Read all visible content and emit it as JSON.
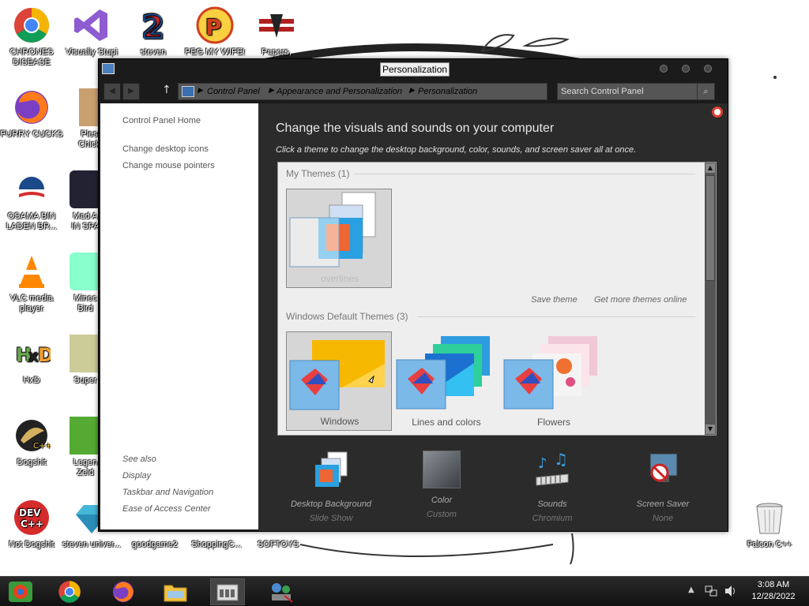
{
  "desktop": {
    "icons": [
      {
        "label": "CHRONES DISEASE",
        "icon": "chrome-icon"
      },
      {
        "label": "Visually Stupi",
        "icon": "visual-studio-icon"
      },
      {
        "label": "steven",
        "icon": "steven-icon"
      },
      {
        "label": "PEG MY WIFE!",
        "icon": "peggle-icon"
      },
      {
        "label": "Papers,",
        "icon": "papers-please-icon"
      },
      {
        "label": "FURRY CUCKS",
        "icon": "firefox-icon"
      },
      {
        "label": "Plese Chicke",
        "icon": "game-icon"
      },
      {
        "label": "OSAMA BIN LADEN BR...",
        "icon": "obama-logo-icon"
      },
      {
        "label": "Mad A IN SPA",
        "icon": "angry-birds-space-icon"
      },
      {
        "label": "VLC media player",
        "icon": "vlc-icon"
      },
      {
        "label": "Minec Bird",
        "icon": "angry-birds-icon"
      },
      {
        "label": "HxD",
        "icon": "hxd-icon"
      },
      {
        "label": "Super",
        "icon": "pixel-game-icon"
      },
      {
        "label": "Dogshit",
        "icon": "codeblocks-icon"
      },
      {
        "label": "Legen Zeld",
        "icon": "zelda-icon"
      },
      {
        "label": "Not Dogshit",
        "icon": "devcpp-icon"
      },
      {
        "label": "steven univer...",
        "icon": "gem-icon"
      },
      {
        "label": "goodgame2",
        "icon": "blank-icon"
      },
      {
        "label": "ShoppingC...",
        "icon": "blank-icon"
      },
      {
        "label": "SOFTOYS",
        "icon": "blank-icon"
      },
      {
        "label": "Falcon C++",
        "icon": "recycle-bin-icon"
      }
    ]
  },
  "window": {
    "title": "Personalization",
    "breadcrumbs": [
      "Control Panel",
      "Appearance and Personalization",
      "Personalization"
    ],
    "search_placeholder": "Search Control Panel",
    "left_pane": {
      "links": [
        "Control Panel Home",
        "Change desktop icons",
        "Change mouse pointers"
      ],
      "see_also_heading": "See also",
      "see_also": [
        "Display",
        "Taskbar and Navigation",
        "Ease of Access Center"
      ]
    },
    "main": {
      "heading": "Change the visuals and sounds on your computer",
      "subheading": "Click a theme to change the desktop background, color, sounds, and screen saver all at once.",
      "my_themes_label": "My Themes (1)",
      "my_themes": [
        {
          "name": "overlines"
        }
      ],
      "save_theme": "Save theme",
      "get_more": "Get more themes online",
      "default_themes_label": "Windows Default Themes (3)",
      "default_themes": [
        {
          "name": "Windows"
        },
        {
          "name": "Lines and colors"
        },
        {
          "name": "Flowers"
        }
      ],
      "bottom": [
        {
          "label": "Desktop Background",
          "value": "Slide Show",
          "icon": "slideshow-icon"
        },
        {
          "label": "Color",
          "value": "Custom",
          "icon": "color-swatch-icon"
        },
        {
          "label": "Sounds",
          "value": "Chromium",
          "icon": "sounds-icon"
        },
        {
          "label": "Screen Saver",
          "value": "None",
          "icon": "screensaver-icon"
        }
      ]
    }
  },
  "taskbar": {
    "apps": [
      "start-icon",
      "chrome-icon",
      "firefox-icon",
      "file-explorer-icon",
      "control-panel-icon",
      "network-app-icon"
    ],
    "time": "3:08 AM",
    "date": "12/28/2022"
  },
  "colors": {
    "window_dark": "#1b1b1b",
    "main_pane": "#2b2b2b",
    "theme_list": "#eeeeee",
    "taskbar": "#1a1a1a"
  }
}
